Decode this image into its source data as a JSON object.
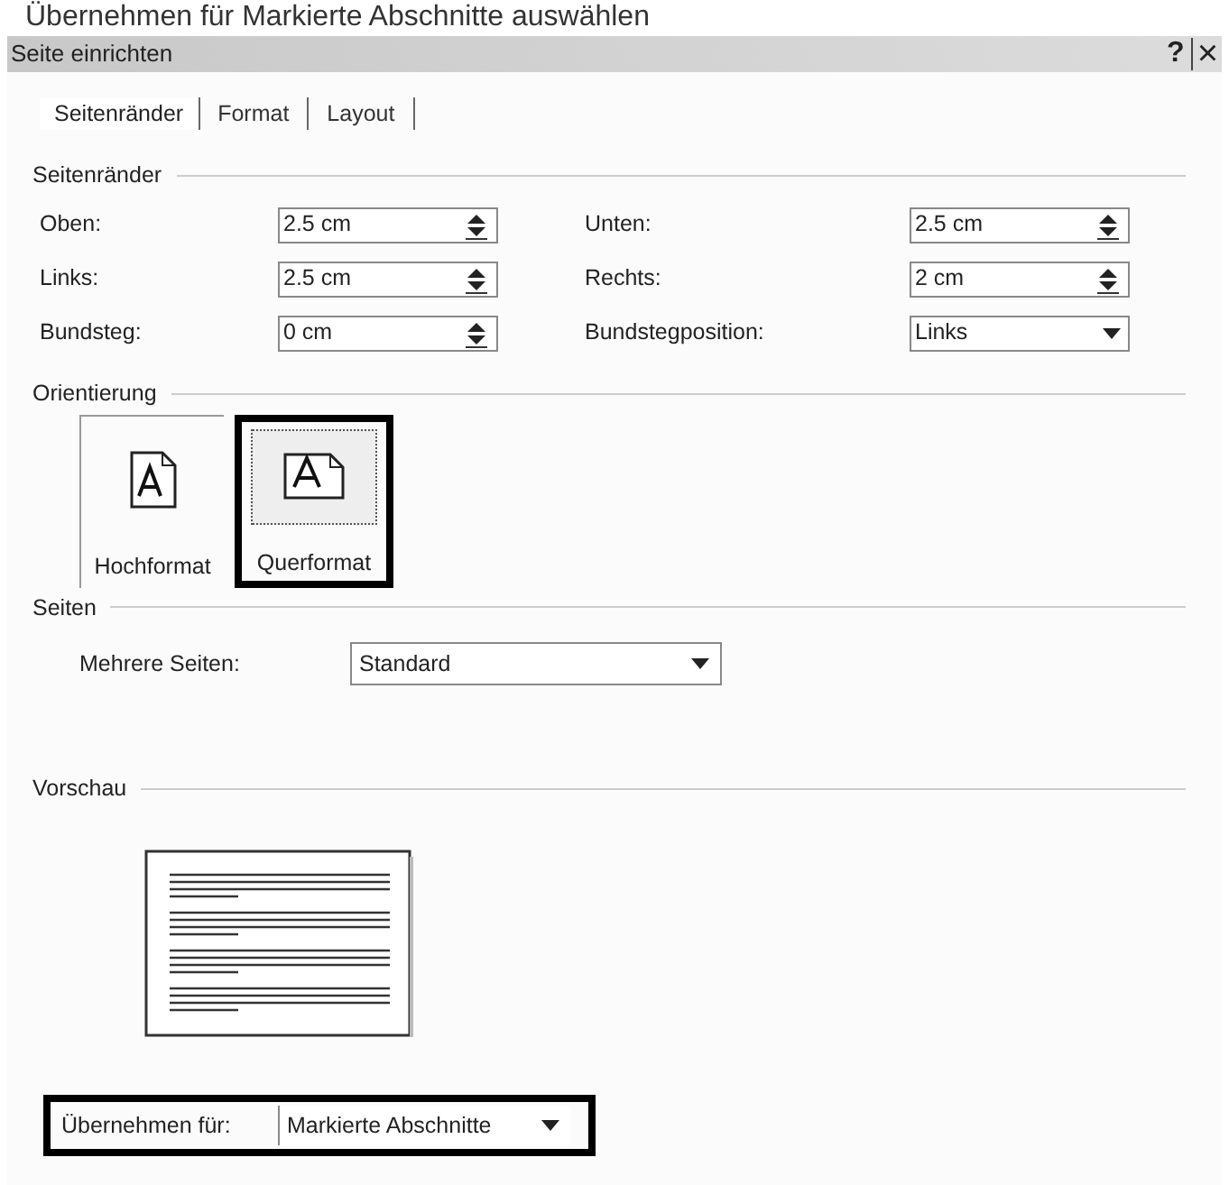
{
  "caption": "Übernehmen für Markierte Abschnitte auswählen",
  "window": {
    "title": "Seite einrichten",
    "help": "?",
    "close": "×"
  },
  "tabs": [
    {
      "label": "Seitenränder",
      "selected": true
    },
    {
      "label": "Format",
      "selected": false
    },
    {
      "label": "Layout",
      "selected": false
    }
  ],
  "margins": {
    "title": "Seitenränder",
    "fields": [
      {
        "label": "Oben:",
        "value": "2.5 cm",
        "kind": "spin"
      },
      {
        "label": "Unten:",
        "value": "2.5 cm",
        "kind": "spin"
      },
      {
        "label": "Links:",
        "value": "2.5 cm",
        "kind": "spin"
      },
      {
        "label": "Rechts:",
        "value": "2 cm",
        "kind": "spin"
      },
      {
        "label": "Bundsteg:",
        "value": "0 cm",
        "kind": "spin"
      },
      {
        "label": "Bundstegposition:",
        "value": "Links",
        "kind": "select"
      }
    ]
  },
  "orientation": {
    "title": "Orientierung",
    "options": [
      {
        "label": "Hochformat",
        "kind": "portrait",
        "selected": false
      },
      {
        "label": "Querformat",
        "kind": "landscape",
        "selected": true
      }
    ]
  },
  "pages": {
    "title": "Seiten",
    "label": "Mehrere Seiten:",
    "value": "Standard"
  },
  "preview": {
    "title": "Vorschau"
  },
  "apply": {
    "label": "Übernehmen für:",
    "value": "Markierte Abschnitte"
  }
}
